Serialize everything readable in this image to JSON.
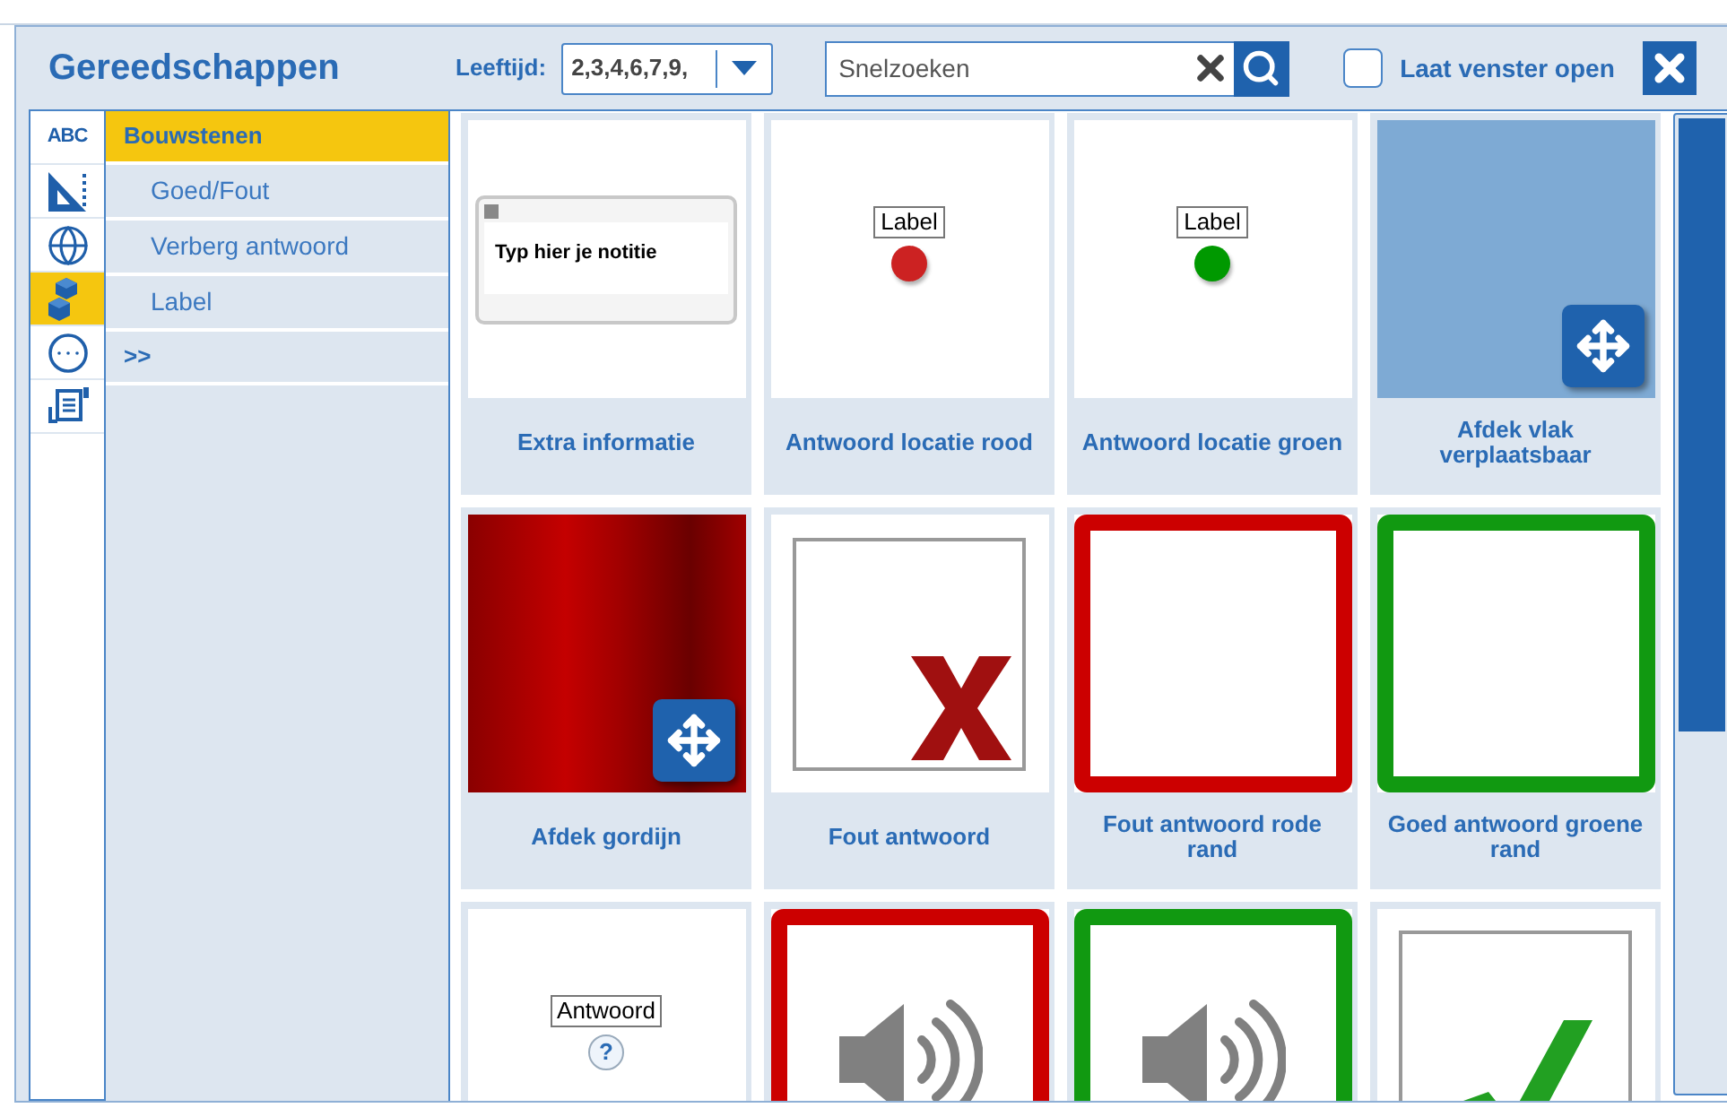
{
  "window": {
    "title": "Gereedschappen"
  },
  "age_filter": {
    "label": "Leeftijd:",
    "value": "2,3,4,6,7,9,"
  },
  "search": {
    "placeholder": "Snelzoeken"
  },
  "keep_open": {
    "label": "Laat venster open",
    "checked": false
  },
  "icon_tabs": [
    {
      "kind": "text",
      "label": "ABC",
      "selected": false
    },
    {
      "kind": "ruler",
      "selected": false
    },
    {
      "kind": "globe",
      "selected": false
    },
    {
      "kind": "blocks",
      "selected": true
    },
    {
      "kind": "more",
      "selected": false
    },
    {
      "kind": "document",
      "selected": false
    }
  ],
  "categories": [
    {
      "label": "Bouwstenen",
      "selected": true,
      "children": [
        {
          "label": "Goed/Fout",
          "selected": false
        },
        {
          "label": "Verberg antwoord",
          "selected": false
        },
        {
          "label": "Label",
          "selected": false
        }
      ]
    },
    {
      "label": ">>",
      "selected": false
    }
  ],
  "tiles": [
    {
      "kind": "note",
      "thumb_text": "Typ hier je notitie",
      "caption": "Extra informatie"
    },
    {
      "kind": "label-dot",
      "color": "#cc2222",
      "thumb_text": "Label",
      "caption": "Antwoord locatie rood"
    },
    {
      "kind": "label-dot",
      "color": "#009900",
      "thumb_text": "Label",
      "caption": "Antwoord locatie groen"
    },
    {
      "kind": "move-area",
      "color": "#7eaad4",
      "caption": "Afdek vlak verplaatsbaar"
    },
    {
      "kind": "curtain",
      "caption": "Afdek gordijn"
    },
    {
      "kind": "cross",
      "caption": "Fout antwoord"
    },
    {
      "kind": "frame",
      "color": "#cc0000",
      "caption": "Fout antwoord rode rand"
    },
    {
      "kind": "frame",
      "color": "#119911",
      "caption": "Goed antwoord groene rand"
    },
    {
      "kind": "question",
      "thumb_text": "Antwoord",
      "thumb_mark": "?"
    },
    {
      "kind": "sound",
      "color": "#cc0000"
    },
    {
      "kind": "sound",
      "color": "#119911"
    },
    {
      "kind": "check"
    }
  ]
}
